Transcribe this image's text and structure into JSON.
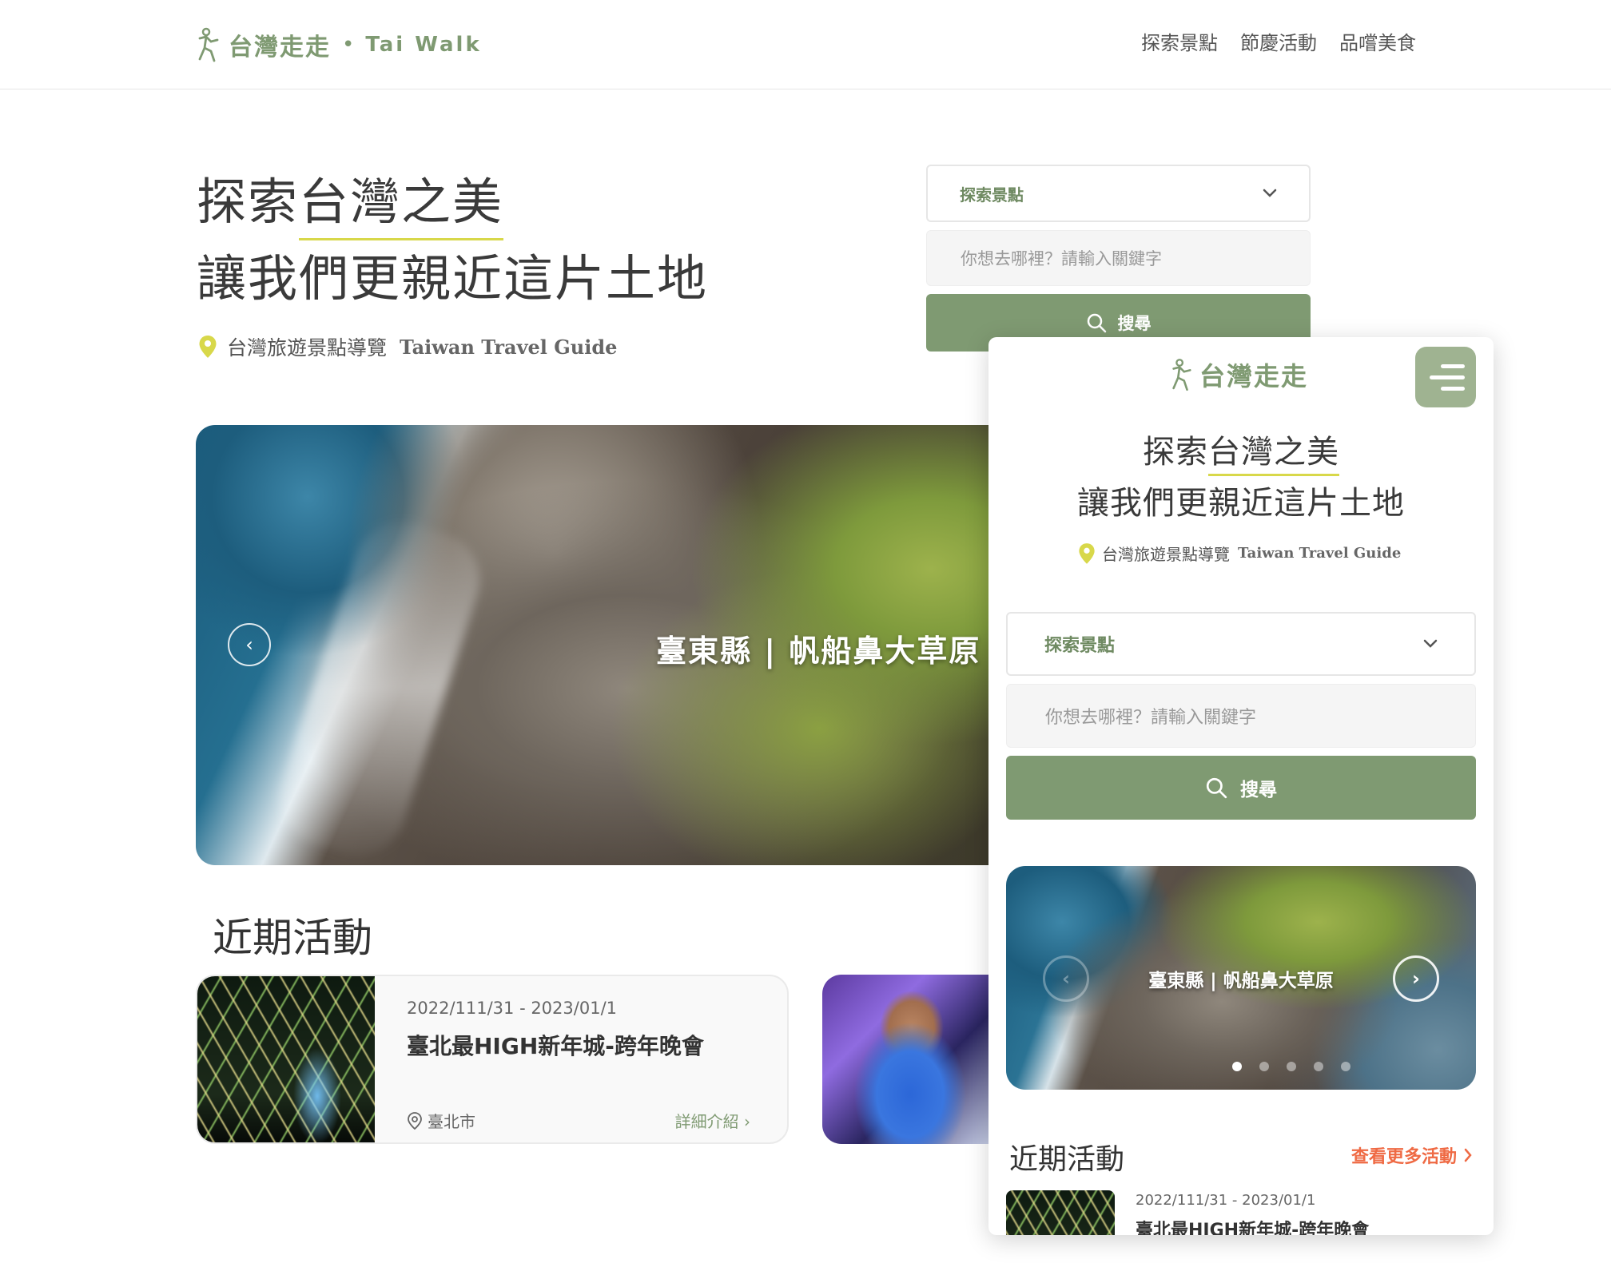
{
  "header": {
    "brand_name": "台灣走走",
    "brand_dot": "•",
    "brand_en": "Tai Walk",
    "nav": [
      "探索景點",
      "節慶活動",
      "品嚐美食"
    ]
  },
  "hero": {
    "title_prefix": "探索",
    "title_highlight": "台灣之美",
    "title_line2": "讓我們更親近這片土地",
    "subtitle_zh": "台灣旅遊景點導覽",
    "subtitle_en": "Taiwan Travel Guide"
  },
  "search": {
    "category": "探索景點",
    "placeholder": "你想去哪裡？請輸入關鍵字",
    "button": "搜尋"
  },
  "carousel": {
    "caption": "臺東縣 | 帆船鼻大草原",
    "prev_symbol": "‹",
    "next_symbol": "›",
    "dot_count": 5,
    "active_dot": 1
  },
  "events": {
    "section_title": "近期活動",
    "more_label": "查看更多活動",
    "items": [
      {
        "date": "2022/111/31 - 2023/01/1",
        "title": "臺北最HIGH新年城-跨年晚會",
        "location": "臺北市",
        "detail_label": "詳細介紹 ›"
      }
    ]
  },
  "mobile": {
    "brand_name": "台灣走走",
    "event_date": "2022/111/31 - 2023/01/1"
  },
  "colors": {
    "brand_green": "#7f9a72",
    "highlight_yellow": "#d8d84a",
    "accent_orange": "#ef6a44"
  }
}
